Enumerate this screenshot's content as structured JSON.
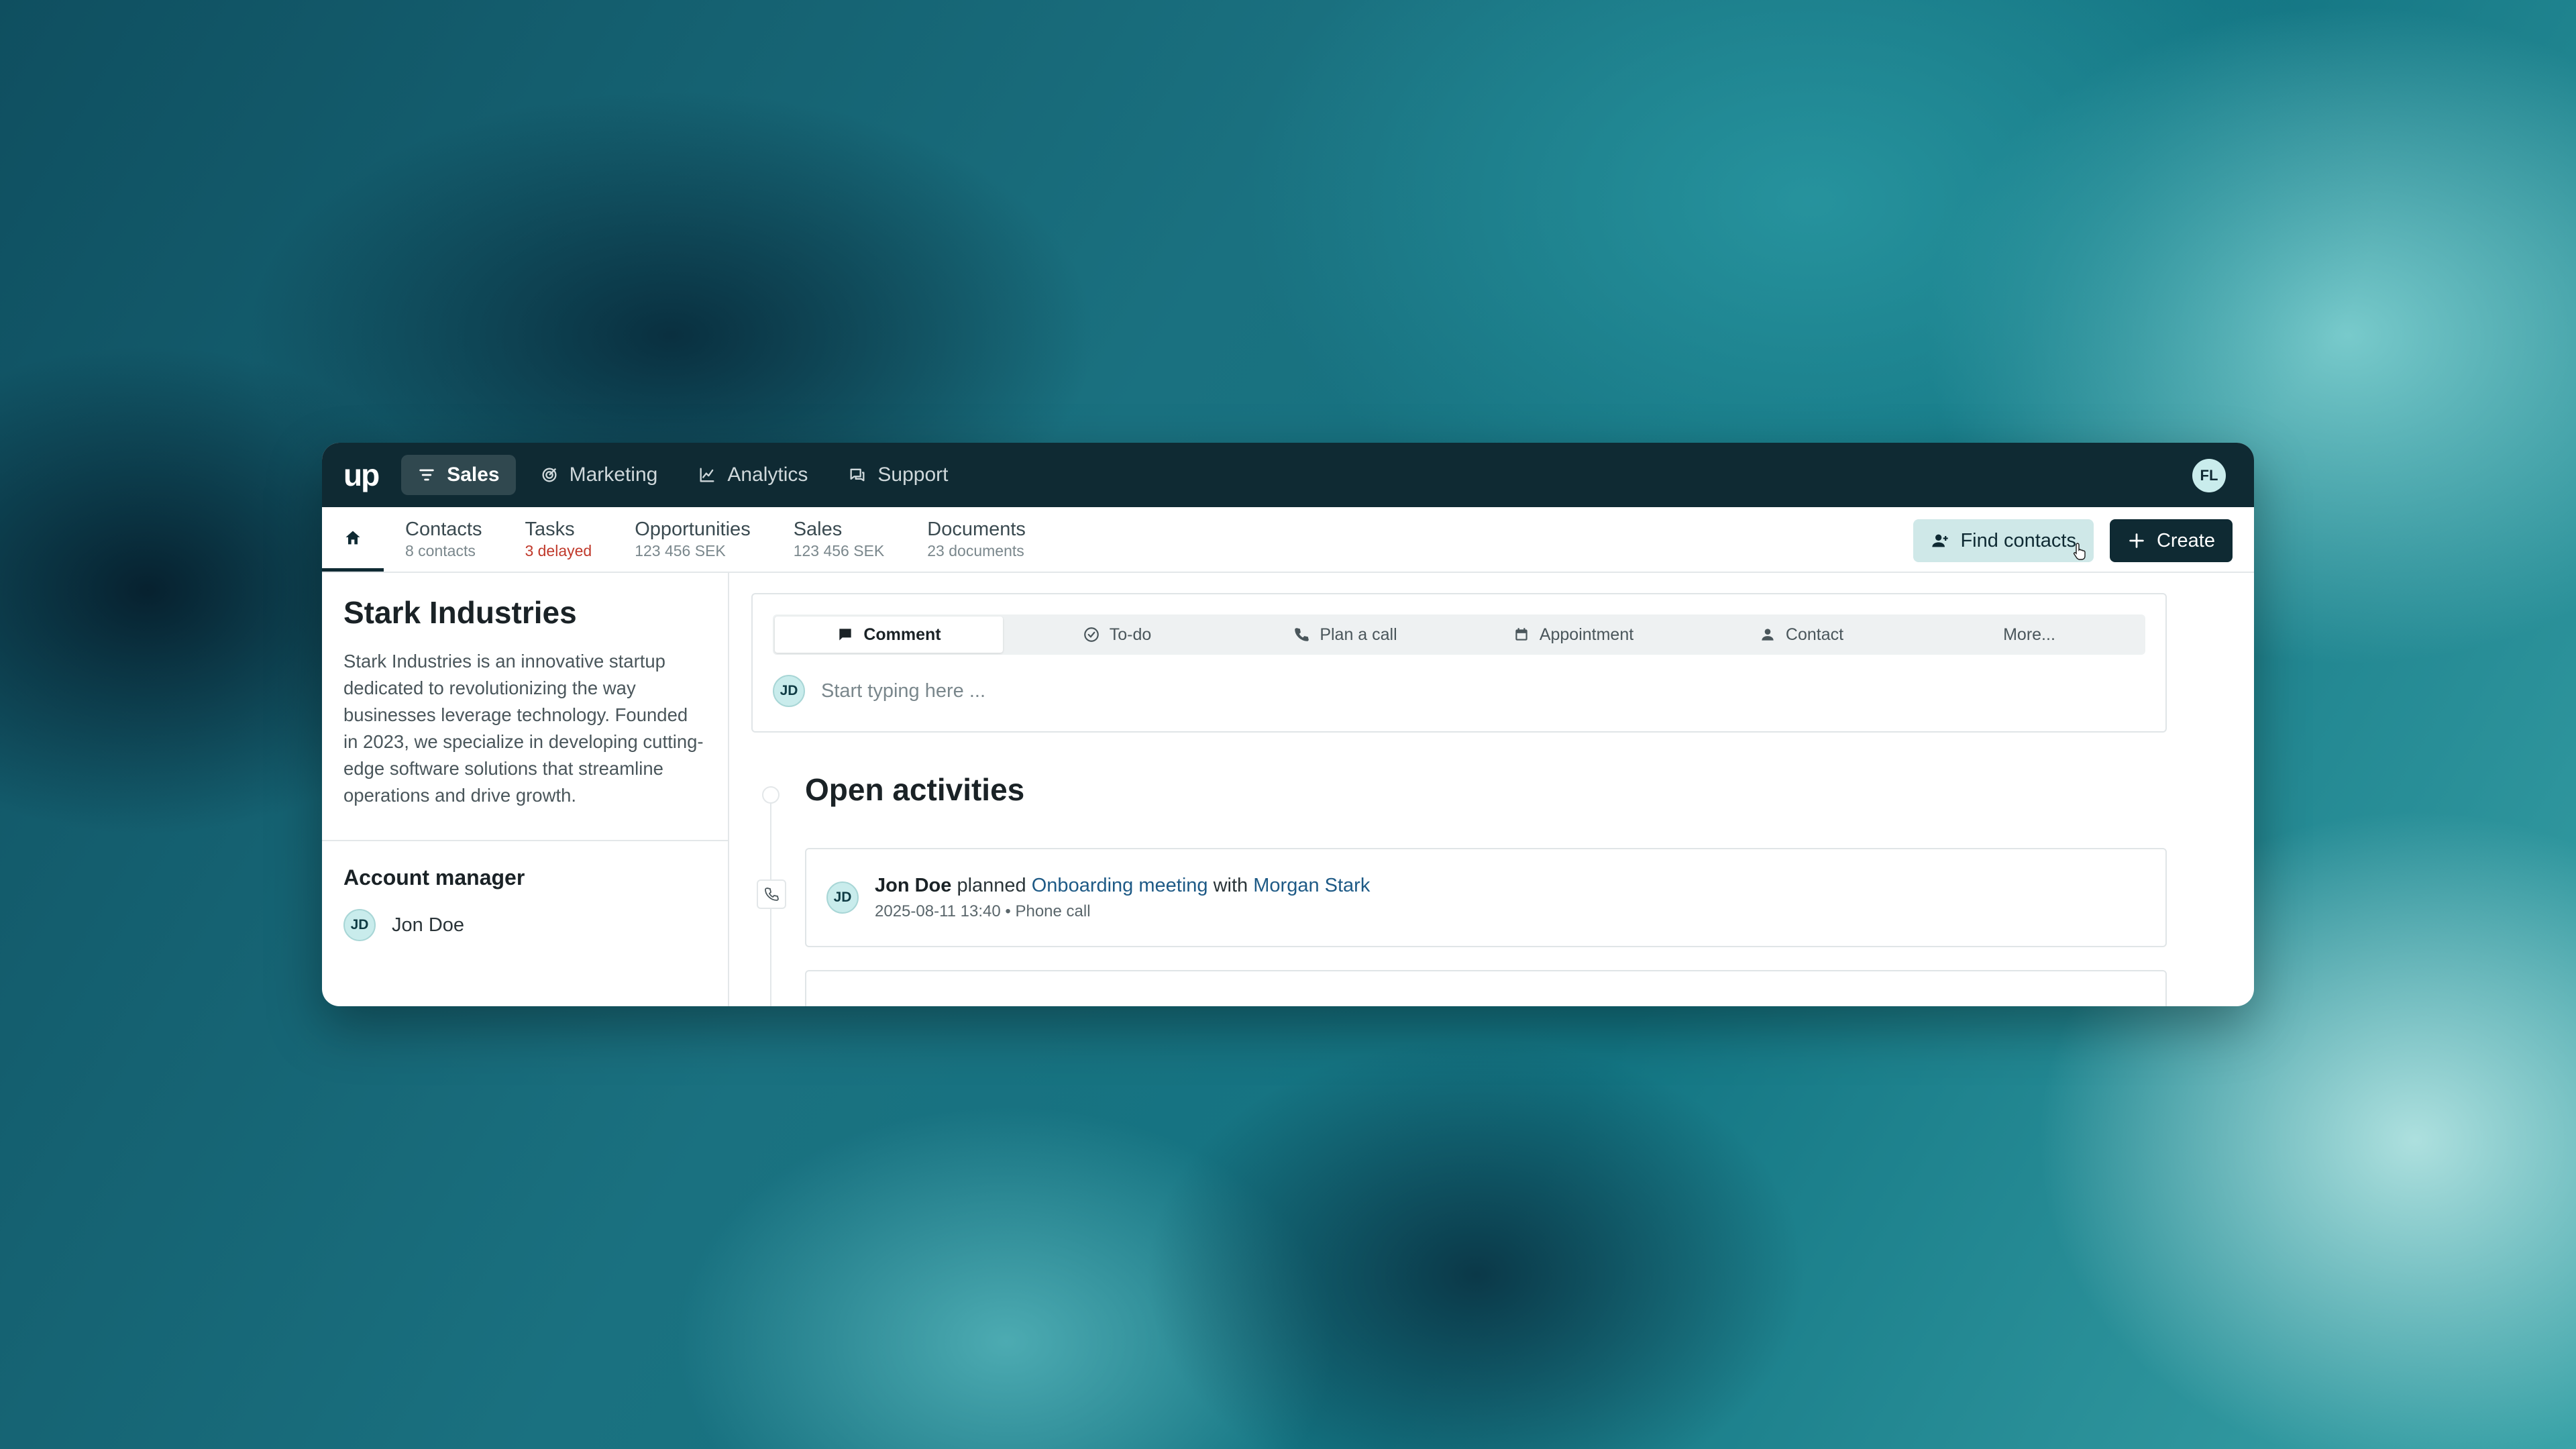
{
  "app": {
    "logo": "up",
    "user_initials": "FL"
  },
  "topnav": [
    {
      "label": "Sales",
      "icon": "filter-icon",
      "active": true
    },
    {
      "label": "Marketing",
      "icon": "target-icon",
      "active": false
    },
    {
      "label": "Analytics",
      "icon": "line-chart-icon",
      "active": false
    },
    {
      "label": "Support",
      "icon": "chat-icon",
      "active": false
    }
  ],
  "subnav": {
    "home_icon": "home-icon",
    "tabs": [
      {
        "title": "Contacts",
        "subtitle": "8 contacts"
      },
      {
        "title": "Tasks",
        "subtitle": "3 delayed"
      },
      {
        "title": "Opportunities",
        "subtitle": "123 456 SEK"
      },
      {
        "title": "Sales",
        "subtitle": "123 456 SEK"
      },
      {
        "title": "Documents",
        "subtitle": "23 documents"
      }
    ],
    "find_contacts_label": "Find contacts",
    "create_label": "Create"
  },
  "company": {
    "name": "Stark Industries",
    "description": "Stark Industries is an innovative startup dedicated to revolutionizing the way businesses leverage technology. Founded in 2023, we specialize in developing cutting-edge software solutions that streamline operations and drive growth."
  },
  "account_manager": {
    "heading": "Account manager",
    "initials": "JD",
    "name": "Jon Doe"
  },
  "composer": {
    "tabs": [
      {
        "label": "Comment",
        "icon": "comment-icon",
        "active": true
      },
      {
        "label": "To-do",
        "icon": "check-circle-icon",
        "active": false
      },
      {
        "label": "Plan a call",
        "icon": "phone-icon",
        "active": false
      },
      {
        "label": "Appointment",
        "icon": "calendar-icon",
        "active": false
      },
      {
        "label": "Contact",
        "icon": "person-icon",
        "active": false
      },
      {
        "label": "More...",
        "icon": "",
        "active": false
      }
    ],
    "initials": "JD",
    "placeholder": "Start typing here ..."
  },
  "open_activities": {
    "title": "Open activities",
    "items": [
      {
        "initials": "JD",
        "actor": "Jon Doe",
        "verb": "planned",
        "subject": "Onboarding meeting",
        "connector": "with",
        "contact": "Morgan Stark",
        "datetime": "2025-08-11 13:40",
        "separator": "•",
        "type": "Phone call",
        "icon": "phone-icon"
      }
    ]
  },
  "colors": {
    "topbar": "#0f2a33",
    "accent_light": "#cfe8e8",
    "link": "#1e5a86",
    "delayed": "#c0392b"
  }
}
